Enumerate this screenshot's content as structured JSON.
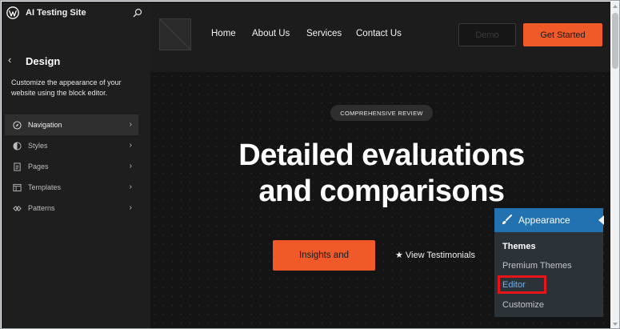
{
  "sidebar": {
    "site_name": "AI Testing Site",
    "title": "Design",
    "description": "Customize the appearance of your website using the block editor.",
    "items": [
      {
        "label": "Navigation",
        "icon": "compass-icon",
        "active": true
      },
      {
        "label": "Styles",
        "icon": "half-circle-icon",
        "active": false
      },
      {
        "label": "Pages",
        "icon": "page-icon",
        "active": false
      },
      {
        "label": "Templates",
        "icon": "layout-icon",
        "active": false
      },
      {
        "label": "Patterns",
        "icon": "diamond-icon",
        "active": false
      }
    ]
  },
  "header": {
    "nav": [
      "Home",
      "About Us",
      "Services",
      "Contact Us"
    ],
    "demo_label": "Demo",
    "cta_label": "Get Started"
  },
  "hero": {
    "badge": "COMPREHENSIVE REVIEW",
    "headline_line1": "Detailed evaluations",
    "headline_line2": "and comparisons",
    "primary_label": "Insights and",
    "secondary_label": "★ View Testimonials"
  },
  "appearance_menu": {
    "title": "Appearance",
    "items": [
      "Themes",
      "Premium Themes",
      "Editor",
      "Customize"
    ]
  },
  "colors": {
    "accent": "#f05a28",
    "wp_blue": "#2271b1",
    "highlight_red": "#e8141a"
  }
}
